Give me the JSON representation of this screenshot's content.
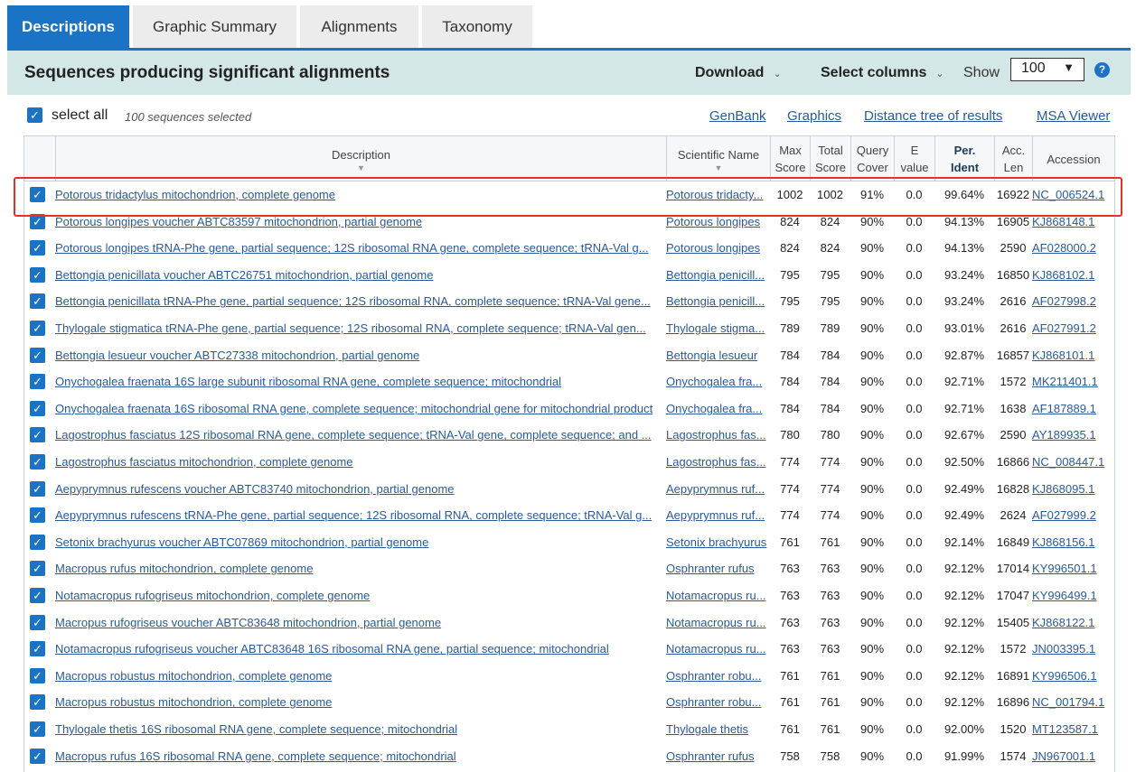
{
  "tabs": [
    "Descriptions",
    "Graphic Summary",
    "Alignments",
    "Taxonomy"
  ],
  "header": {
    "title": "Sequences producing significant alignments",
    "download_label": "Download",
    "select_columns_label": "Select columns",
    "show_label": "Show",
    "show_value": "100",
    "help_icon": "question-icon"
  },
  "select_row": {
    "select_all_label": "select all",
    "selected_count": "100 sequences selected",
    "links": [
      "GenBank",
      "Graphics",
      "Distance tree of results",
      "MSA Viewer"
    ]
  },
  "columns": {
    "description": "Description",
    "scientific_name": "Scientific Name",
    "max_score": [
      "Max",
      "Score"
    ],
    "total_score": [
      "Total",
      "Score"
    ],
    "query_cover": [
      "Query",
      "Cover"
    ],
    "e_value": [
      "E",
      "value"
    ],
    "per_ident": [
      "Per.",
      "Ident"
    ],
    "acc_len": [
      "Acc.",
      "Len"
    ],
    "accession": "Accession"
  },
  "rows": [
    {
      "desc": "Potorous tridactylus mitochondrion, complete genome",
      "sci": "Potorous tridacty...",
      "max": "1002",
      "total": "1002",
      "cover": "91%",
      "e": "0.0",
      "ident": "99.64%",
      "len": "16922",
      "acc": "NC_006524.1"
    },
    {
      "desc": "Potorous longipes voucher ABTC83597 mitochondrion, partial genome",
      "sci": "Potorous longipes",
      "max": "824",
      "total": "824",
      "cover": "90%",
      "e": "0.0",
      "ident": "94.13%",
      "len": "16905",
      "acc": "KJ868148.1"
    },
    {
      "desc": "Potorous longipes tRNA-Phe gene, partial sequence; 12S ribosomal RNA gene, complete sequence; tRNA-Val g...",
      "sci": "Potorous longipes",
      "max": "824",
      "total": "824",
      "cover": "90%",
      "e": "0.0",
      "ident": "94.13%",
      "len": "2590",
      "acc": "AF028000.2"
    },
    {
      "desc": "Bettongia penicillata voucher ABTC26751 mitochondrion, partial genome",
      "sci": "Bettongia penicill...",
      "max": "795",
      "total": "795",
      "cover": "90%",
      "e": "0.0",
      "ident": "93.24%",
      "len": "16850",
      "acc": "KJ868102.1"
    },
    {
      "desc": "Bettongia penicillata tRNA-Phe gene, partial sequence; 12S ribosomal RNA, complete sequence; tRNA-Val gene...",
      "sci": "Bettongia penicill...",
      "max": "795",
      "total": "795",
      "cover": "90%",
      "e": "0.0",
      "ident": "93.24%",
      "len": "2616",
      "acc": "AF027998.2"
    },
    {
      "desc": "Thylogale stigmatica tRNA-Phe gene, partial sequence; 12S ribosomal RNA, complete sequence; tRNA-Val gen...",
      "sci": "Thylogale stigma...",
      "max": "789",
      "total": "789",
      "cover": "90%",
      "e": "0.0",
      "ident": "93.01%",
      "len": "2616",
      "acc": "AF027991.2"
    },
    {
      "desc": "Bettongia lesueur voucher ABTC27338 mitochondrion, partial genome",
      "sci": "Bettongia lesueur",
      "max": "784",
      "total": "784",
      "cover": "90%",
      "e": "0.0",
      "ident": "92.87%",
      "len": "16857",
      "acc": "KJ868101.1"
    },
    {
      "desc": "Onychogalea fraenata 16S large subunit ribosomal RNA gene, complete sequence; mitochondrial",
      "sci": "Onychogalea fra...",
      "max": "784",
      "total": "784",
      "cover": "90%",
      "e": "0.0",
      "ident": "92.71%",
      "len": "1572",
      "acc": "MK211401.1"
    },
    {
      "desc": "Onychogalea fraenata 16S ribosomal RNA gene, complete sequence; mitochondrial gene for mitochondrial product",
      "sci": "Onychogalea fra...",
      "max": "784",
      "total": "784",
      "cover": "90%",
      "e": "0.0",
      "ident": "92.71%",
      "len": "1638",
      "acc": "AF187889.1"
    },
    {
      "desc": "Lagostrophus fasciatus 12S ribosomal RNA gene, complete sequence; tRNA-Val gene, complete sequence; and ...",
      "sci": "Lagostrophus fas...",
      "max": "780",
      "total": "780",
      "cover": "90%",
      "e": "0.0",
      "ident": "92.67%",
      "len": "2590",
      "acc": "AY189935.1"
    },
    {
      "desc": "Lagostrophus fasciatus mitochondrion, complete genome",
      "sci": "Lagostrophus fas...",
      "max": "774",
      "total": "774",
      "cover": "90%",
      "e": "0.0",
      "ident": "92.50%",
      "len": "16866",
      "acc": "NC_008447.1"
    },
    {
      "desc": "Aepyprymnus rufescens voucher ABTC83740 mitochondrion, partial genome",
      "sci": "Aepyprymnus ruf...",
      "max": "774",
      "total": "774",
      "cover": "90%",
      "e": "0.0",
      "ident": "92.49%",
      "len": "16828",
      "acc": "KJ868095.1"
    },
    {
      "desc": "Aepyprymnus rufescens tRNA-Phe gene, partial sequence; 12S ribosomal RNA, complete sequence; tRNA-Val g...",
      "sci": "Aepyprymnus ruf...",
      "max": "774",
      "total": "774",
      "cover": "90%",
      "e": "0.0",
      "ident": "92.49%",
      "len": "2624",
      "acc": "AF027999.2"
    },
    {
      "desc": "Setonix brachyurus voucher ABTC07869 mitochondrion, partial genome",
      "sci": "Setonix brachyurus",
      "max": "761",
      "total": "761",
      "cover": "90%",
      "e": "0.0",
      "ident": "92.14%",
      "len": "16849",
      "acc": "KJ868156.1"
    },
    {
      "desc": "Macropus rufus mitochondrion, complete genome",
      "sci": "Osphranter rufus",
      "max": "763",
      "total": "763",
      "cover": "90%",
      "e": "0.0",
      "ident": "92.12%",
      "len": "17014",
      "acc": "KY996501.1"
    },
    {
      "desc": "Notamacropus rufogriseus mitochondrion, complete genome",
      "sci": "Notamacropus ru...",
      "max": "763",
      "total": "763",
      "cover": "90%",
      "e": "0.0",
      "ident": "92.12%",
      "len": "17047",
      "acc": "KY996499.1"
    },
    {
      "desc": "Macropus rufogriseus voucher ABTC83648 mitochondrion, partial genome",
      "sci": "Notamacropus ru...",
      "max": "763",
      "total": "763",
      "cover": "90%",
      "e": "0.0",
      "ident": "92.12%",
      "len": "15405",
      "acc": "KJ868122.1"
    },
    {
      "desc": "Notamacropus rufogriseus voucher ABTC83648 16S ribosomal RNA gene, partial sequence; mitochondrial",
      "sci": "Notamacropus ru...",
      "max": "763",
      "total": "763",
      "cover": "90%",
      "e": "0.0",
      "ident": "92.12%",
      "len": "1572",
      "acc": "JN003395.1"
    },
    {
      "desc": "Macropus robustus mitochondrion, complete genome",
      "sci": "Osphranter robu...",
      "max": "761",
      "total": "761",
      "cover": "90%",
      "e": "0.0",
      "ident": "92.12%",
      "len": "16891",
      "acc": "KY996506.1"
    },
    {
      "desc": "Macropus robustus mitochondrion, complete genome",
      "sci": "Osphranter robu...",
      "max": "761",
      "total": "761",
      "cover": "90%",
      "e": "0.0",
      "ident": "92.12%",
      "len": "16896",
      "acc": "NC_001794.1"
    },
    {
      "desc": "Thylogale thetis 16S ribosomal RNA gene, complete sequence; mitochondrial",
      "sci": "Thylogale thetis",
      "max": "761",
      "total": "761",
      "cover": "90%",
      "e": "0.0",
      "ident": "92.00%",
      "len": "1520",
      "acc": "MT123587.1"
    },
    {
      "desc": "Macropus rufus 16S ribosomal RNA gene, complete sequence; mitochondrial",
      "sci": "Osphranter rufus",
      "max": "758",
      "total": "758",
      "cover": "90%",
      "e": "0.0",
      "ident": "91.99%",
      "len": "1574",
      "acc": "JN967001.1"
    }
  ],
  "colors": {
    "accent": "#1b73c6",
    "header_bg": "#d3e7e6",
    "link": "#2a5a9a",
    "highlight_border": "#e0342a"
  }
}
